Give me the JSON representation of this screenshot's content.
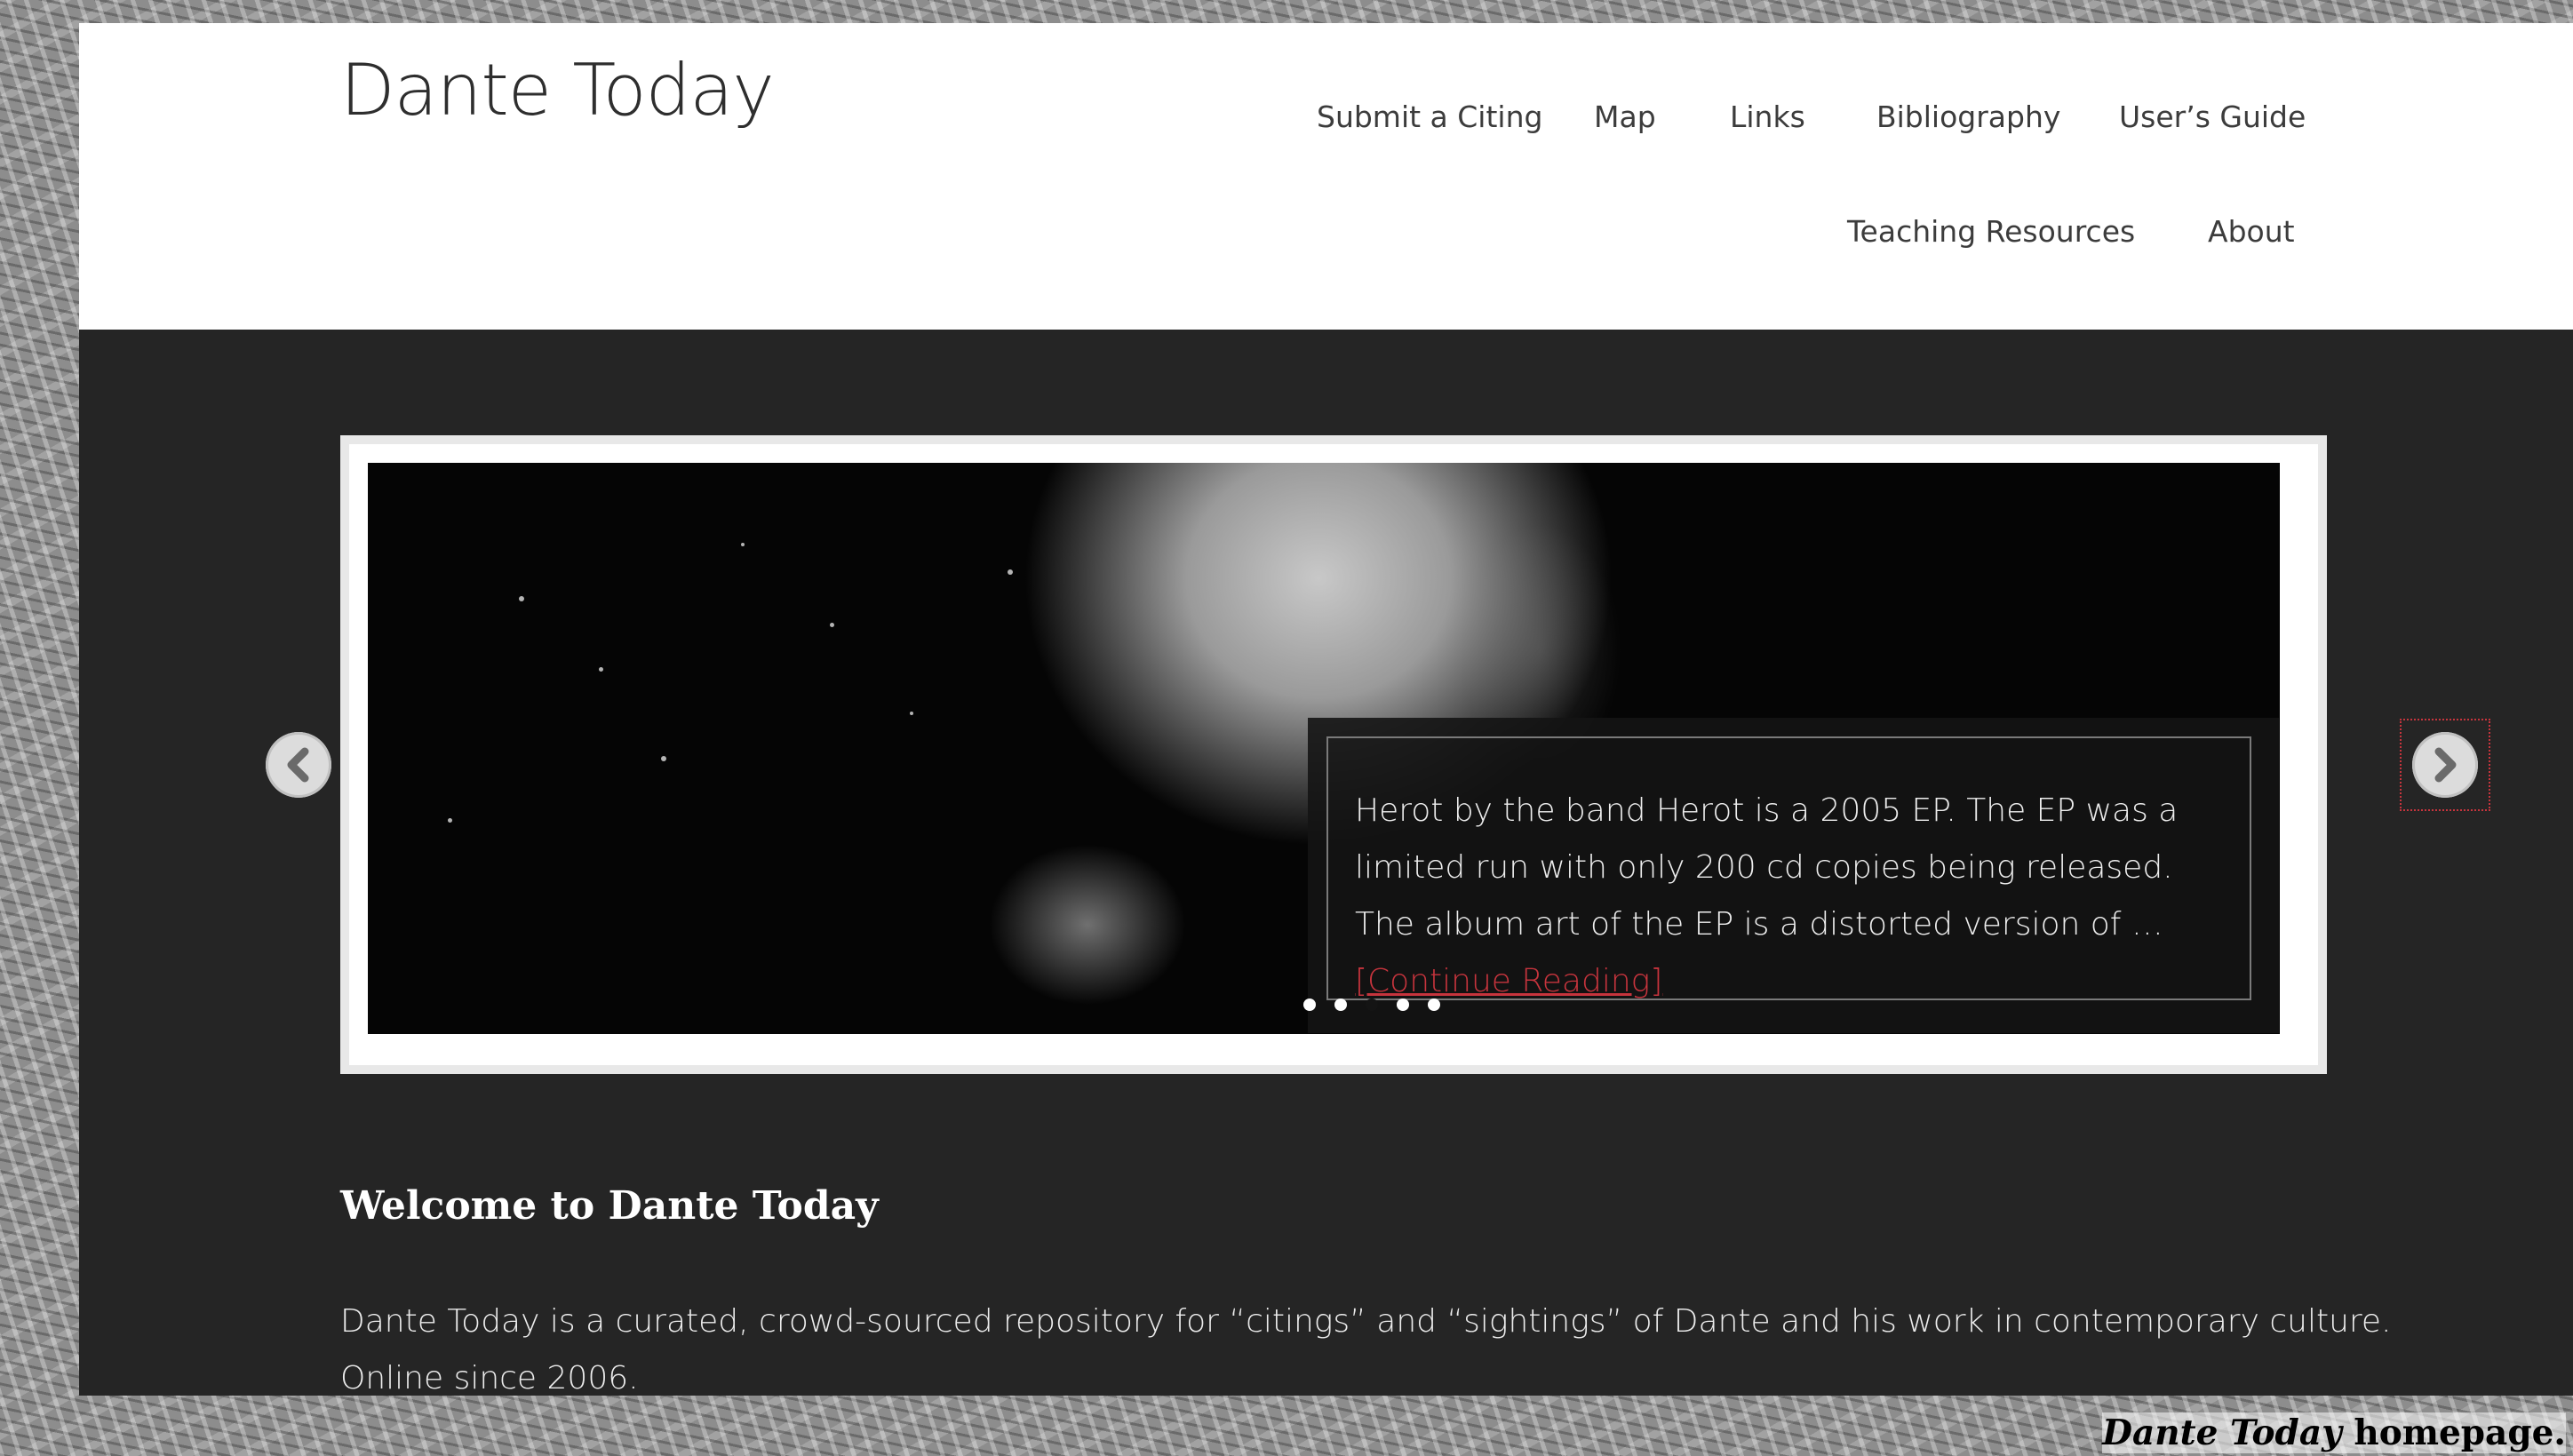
{
  "site": {
    "title": "Dante Today"
  },
  "nav": {
    "items": [
      {
        "label": "Submit a Citing"
      },
      {
        "label": "Map"
      },
      {
        "label": "Links"
      },
      {
        "label": "Bibliography"
      },
      {
        "label": "User’s Guide"
      },
      {
        "label": "Teaching Resources"
      },
      {
        "label": "About"
      }
    ]
  },
  "slider": {
    "caption": "Herot by the band Herot is a 2005 EP. The EP was a limited run with only 200 cd copies being released. The album art of the EP is a distorted version of …",
    "continue_label": "[Continue Reading]",
    "prev_icon": "chevron-left-icon",
    "next_icon": "chevron-right-icon",
    "slide_count": 5,
    "active_slide": 3
  },
  "welcome": {
    "heading": "Welcome to Dante Today",
    "text": "Dante Today is a curated, crowd-sourced repository for “citings” and “sightings” of Dante and his work in contemporary culture. Online since 2006."
  },
  "figure_caption": {
    "italic": "Dante Today",
    "rest": " homepage."
  },
  "colors": {
    "accent_link": "#c7343d",
    "content_background": "#252525",
    "header_background": "#ffffff"
  }
}
